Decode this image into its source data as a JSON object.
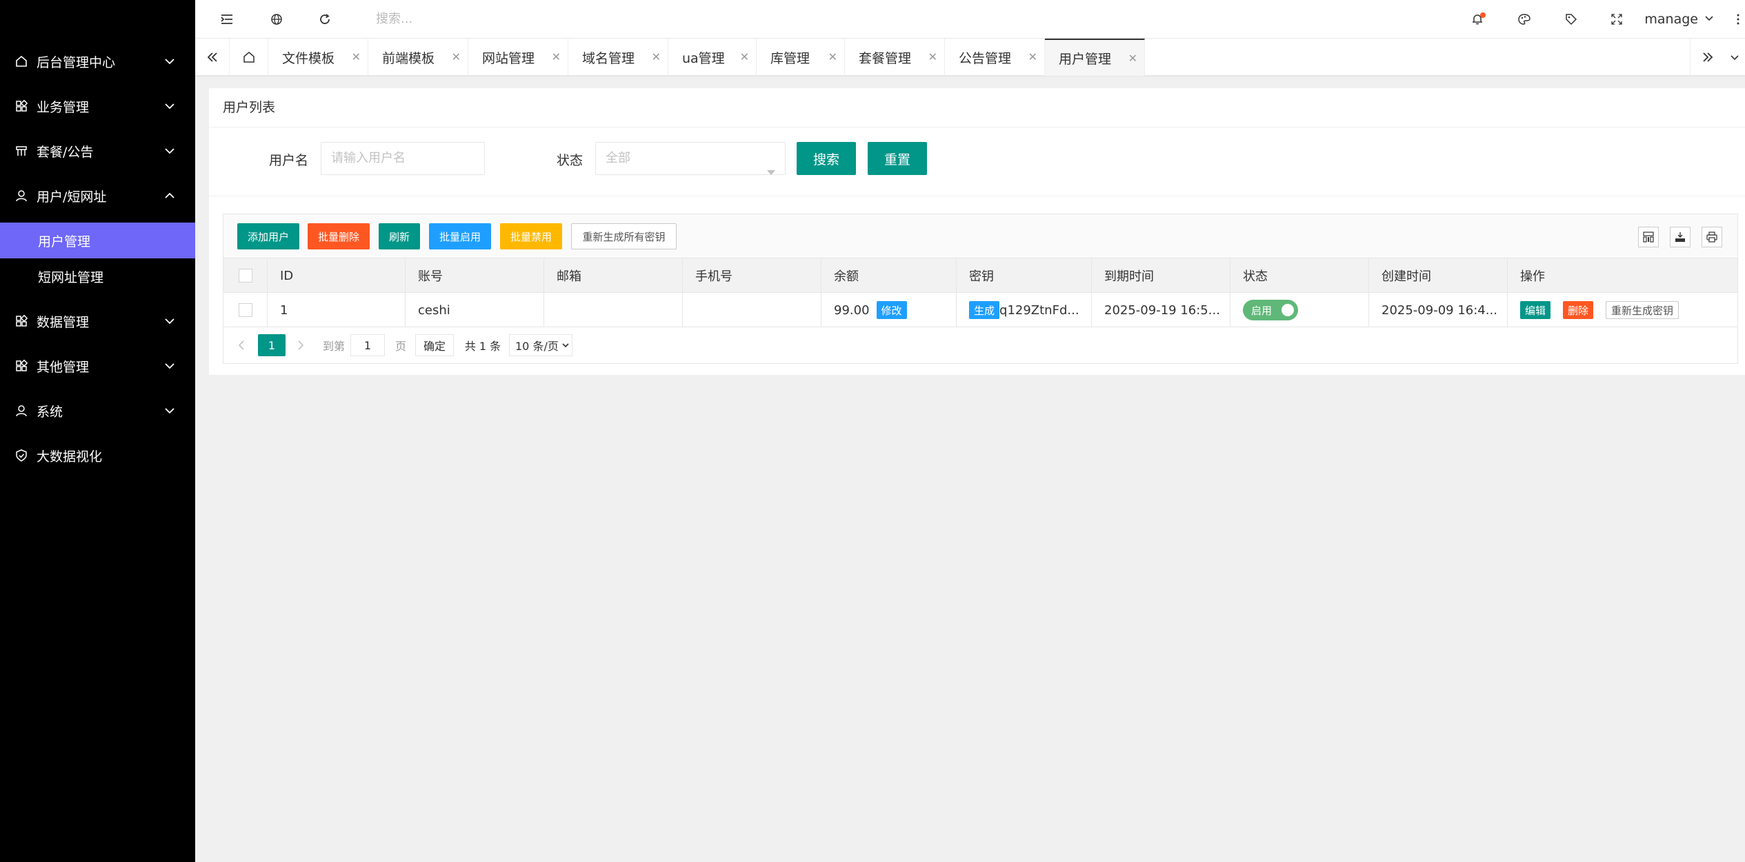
{
  "sidebar": {
    "items": [
      {
        "label": "后台管理中心",
        "icon": "home-icon"
      },
      {
        "label": "业务管理",
        "icon": "apps-icon"
      },
      {
        "label": "套餐/公告",
        "icon": "store-icon"
      },
      {
        "label": "用户/短网址",
        "icon": "user-icon"
      },
      {
        "label": "数据管理",
        "icon": "apps-icon"
      },
      {
        "label": "其他管理",
        "icon": "apps-icon"
      },
      {
        "label": "系统",
        "icon": "user-icon"
      },
      {
        "label": "大数据视化",
        "icon": "shield-icon"
      }
    ],
    "sub_items": [
      {
        "label": "用户管理",
        "active": true
      },
      {
        "label": "短网址管理",
        "active": false
      }
    ]
  },
  "header": {
    "search_placeholder": "搜索...",
    "user": "manage"
  },
  "tabs": [
    {
      "label": "文件模板"
    },
    {
      "label": "前端模板"
    },
    {
      "label": "网站管理"
    },
    {
      "label": "域名管理"
    },
    {
      "label": "ua管理"
    },
    {
      "label": "库管理"
    },
    {
      "label": "套餐管理"
    },
    {
      "label": "公告管理"
    },
    {
      "label": "用户管理",
      "active": true
    }
  ],
  "card": {
    "title": "用户列表",
    "username_label": "用户名",
    "username_placeholder": "请输入用户名",
    "status_label": "状态",
    "status_value": "全部",
    "search_button": "搜索",
    "reset_button": "重置"
  },
  "toolbar": {
    "add": "添加用户",
    "batch_delete": "批量删除",
    "refresh": "刷新",
    "batch_enable": "批量启用",
    "batch_disable": "批量禁用",
    "regen_all": "重新生成所有密钥"
  },
  "table": {
    "columns": [
      "ID",
      "账号",
      "邮箱",
      "手机号",
      "余额",
      "密钥",
      "到期时间",
      "状态",
      "创建时间",
      "操作"
    ],
    "rows": [
      {
        "id": "1",
        "account": "ceshi",
        "email": "",
        "phone": "",
        "balance": "99.00",
        "balance_action": "修改",
        "key_action": "生成",
        "key": "q129ZtnFd...",
        "expire": "2025-09-19 16:5...",
        "status": "启用",
        "created": "2025-09-09 16:4...",
        "edit": "编辑",
        "delete": "删除",
        "regen": "重新生成密钥"
      }
    ]
  },
  "pager": {
    "current": "1",
    "goto_label": "到第",
    "goto_value": "1",
    "page_label": "页",
    "confirm": "确定",
    "total": "共 1 条",
    "per_page": "10 条/页"
  },
  "colors": {
    "teal": "#009688",
    "orange": "#ff5722",
    "blue": "#1e9fff",
    "yellow": "#ffb800",
    "green_switch": "#5fb878",
    "sidebar_active": "#6e67f7"
  }
}
